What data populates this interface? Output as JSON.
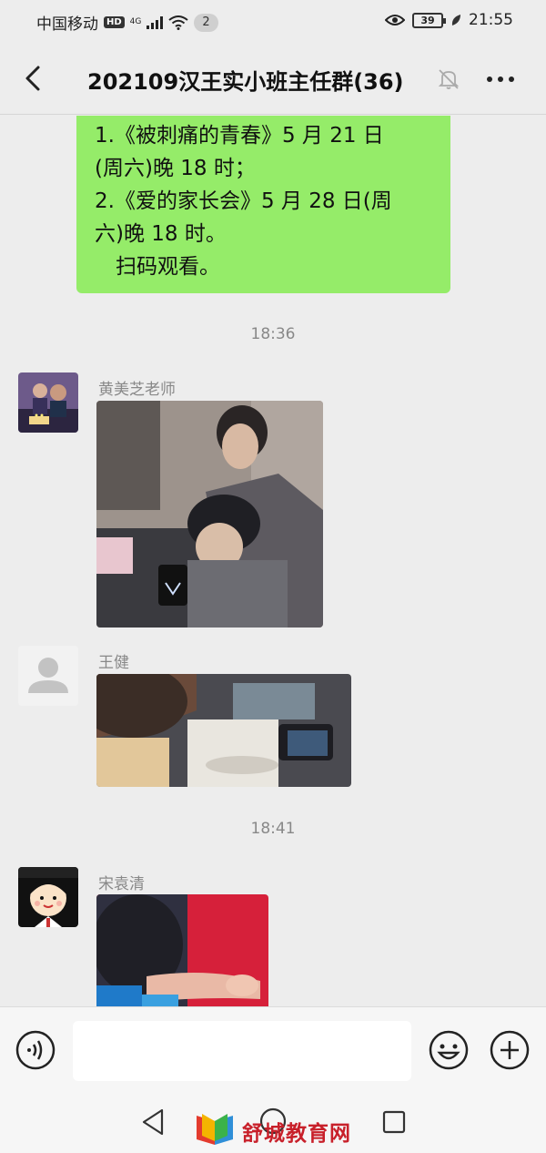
{
  "status_bar": {
    "carrier": "中国移动",
    "hd": "HD",
    "network": "4G",
    "notification_count": "2",
    "battery": "39",
    "time": "21:55"
  },
  "header": {
    "title": "202109汉王实小班主任群(36)"
  },
  "messages": {
    "green_bubble": {
      "lines": [
        "1.《被刺痛的青春》5 月 21 日",
        "(周六)晚 18 时；",
        "2.《爱的家长会》5 月 28 日(周",
        "六)晚 18 时。",
        "　扫码观看。"
      ]
    },
    "timestamp_1": "18:36",
    "sender_1": "黄美芝老师",
    "sender_2": "王健",
    "timestamp_2": "18:41",
    "sender_3": "宋袁清"
  },
  "colors": {
    "bubble_green": "#95ec69",
    "background": "#ededed",
    "watermark_red": "#c8202a"
  },
  "watermark": {
    "text": "舒城教育网"
  }
}
